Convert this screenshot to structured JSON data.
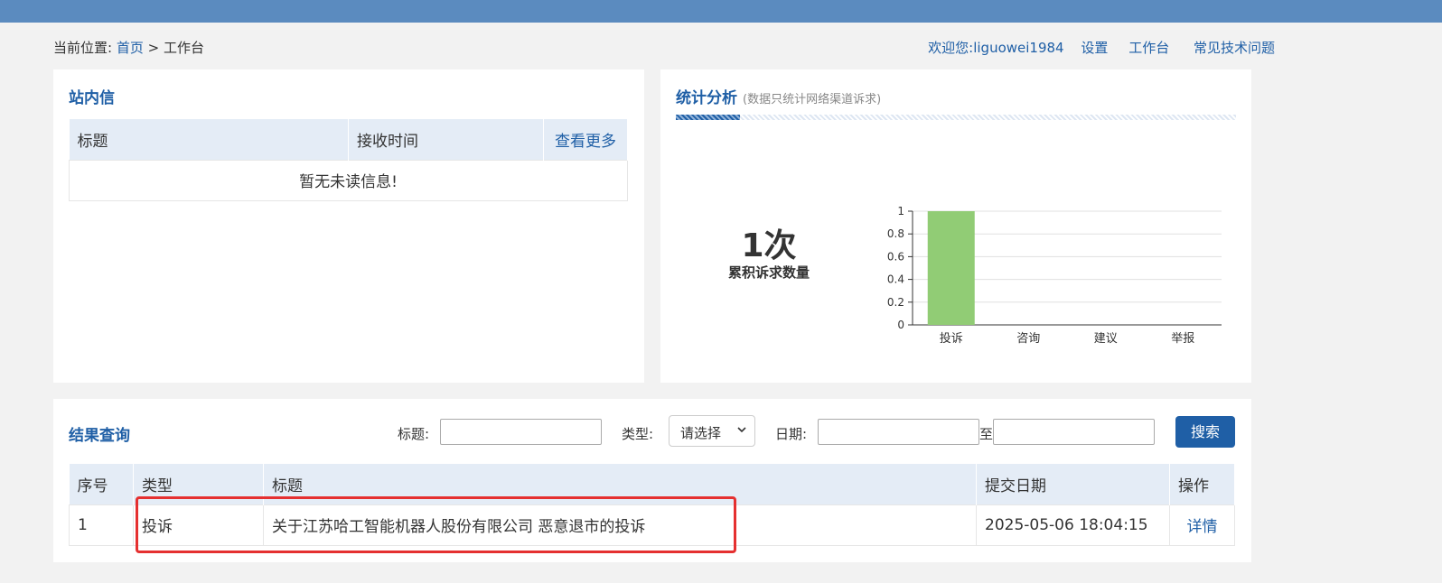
{
  "breadcrumb": {
    "prefix": "当前位置:",
    "home": "首页",
    "sep": ">",
    "current": "工作台"
  },
  "user": {
    "welcome": "欢迎您:liguowei1984",
    "settings": "设置",
    "workbench": "工作台",
    "faq": "常见技术问题"
  },
  "inbox": {
    "title": "站内信",
    "columns": [
      "标题",
      "接收时间",
      "查看更多"
    ],
    "empty": "暂无未读信息!"
  },
  "stats": {
    "title": "统计分析",
    "note": "(数据只统计网络渠道诉求)",
    "count": "1次",
    "count_label": "累积诉求数量"
  },
  "chart_data": {
    "type": "bar",
    "categories": [
      "投诉",
      "咨询",
      "建议",
      "举报"
    ],
    "values": [
      1,
      0,
      0,
      0
    ],
    "yticks": [
      "0",
      "0.2",
      "0.4",
      "0.6",
      "0.8",
      "1"
    ],
    "ylim": [
      0,
      1
    ],
    "grid": true,
    "bar_color": "#91cc75"
  },
  "query": {
    "title": "结果查询",
    "label_title": "标题:",
    "label_type": "类型:",
    "type_selected": "请选择",
    "label_date": "日期:",
    "date_sep": "至",
    "search": "搜索",
    "columns": [
      "序号",
      "类型",
      "标题",
      "提交日期",
      "操作"
    ],
    "rows": [
      {
        "no": "1",
        "type": "投诉",
        "title": "关于江苏哈工智能机器人股份有限公司 恶意退市的投诉",
        "date": "2025-05-06 18:04:15",
        "action": "详情"
      }
    ]
  },
  "colors": {
    "topbar": "#5b8bbf",
    "link": "#1f5fa6",
    "highlight": "#e53030"
  }
}
